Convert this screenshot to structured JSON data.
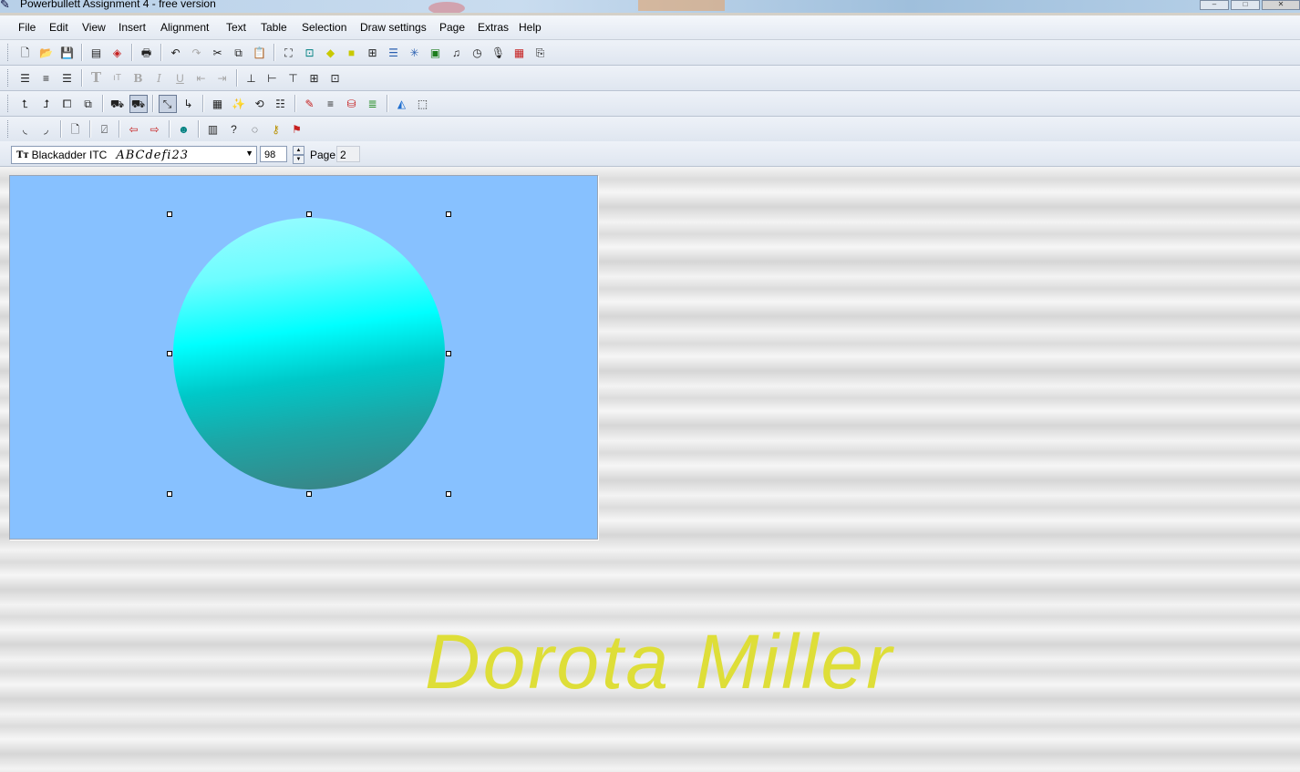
{
  "window": {
    "title": "Powerbullett Assignment 4 - free version",
    "app_icon": "app-logo-icon",
    "controls": [
      "minimize",
      "maximize",
      "close"
    ]
  },
  "menu": {
    "items": [
      "File",
      "Edit",
      "View",
      "Insert",
      "Alignment",
      "Text",
      "Table",
      "Selection",
      "Draw settings",
      "Page",
      "Extras",
      "Help"
    ]
  },
  "toolbar1": {
    "icons": [
      "new-document-icon",
      "open-folder-icon",
      "save-icon",
      "page-view-icon",
      "package-icon",
      "print-icon",
      "undo-icon",
      "redo-icon",
      "cut-icon",
      "copy-icon",
      "paste-icon",
      "fit-all-icon",
      "fit-width-icon",
      "fit-height-icon",
      "fit-page-icon",
      "grid-icon",
      "list-icon",
      "snap-icon",
      "frame-icon",
      "music-icon",
      "clock-icon",
      "microphone-icon",
      "slideshow-icon",
      "export-icon"
    ]
  },
  "toolbar2": {
    "icons": [
      "align-left-icon",
      "align-center-icon",
      "align-right-icon",
      "text-size-icon",
      "text-small-icon",
      "bold-icon",
      "italic-icon",
      "underline-icon",
      "indent-decrease-icon",
      "indent-increase-icon",
      "insert-row-icon",
      "insert-column-icon",
      "split-cell-icon",
      "merge-icon",
      "table-fit-icon"
    ]
  },
  "toolbar3": {
    "icons": [
      "bring-front-icon",
      "send-back-icon",
      "group-icon",
      "ungroup-icon",
      "stamp-icon",
      "stamp-selected-icon",
      "resize-icon",
      "corner-icon",
      "calendar-icon",
      "magic-wand-icon",
      "flip-icon",
      "layers-icon",
      "pen-color-icon",
      "line-width-icon",
      "fill-icon",
      "color-bars-icon",
      "fill-color-icon",
      "border-icon"
    ]
  },
  "toolbar4": {
    "icons": [
      "shape-left-icon",
      "shape-right-icon",
      "new-page-icon",
      "delete-page-icon",
      "previous-page-icon",
      "next-page-icon",
      "users-icon",
      "book-icon",
      "help-icon",
      "comment-icon",
      "key-icon",
      "flag-icon"
    ]
  },
  "font_row": {
    "font_name": "Blackadder ITC",
    "font_sample": "ABCdefi23",
    "font_size": "98",
    "page_label": "Page",
    "page_number": "2"
  },
  "canvas": {
    "slide_background": "#87c1ff",
    "circle_colors": [
      "#9ffcff",
      "#00ffff",
      "#1da5a5",
      "#3f7e80"
    ],
    "circle_selected": true
  },
  "signature": {
    "text": "Dorota Miller",
    "color": "#dede38"
  }
}
